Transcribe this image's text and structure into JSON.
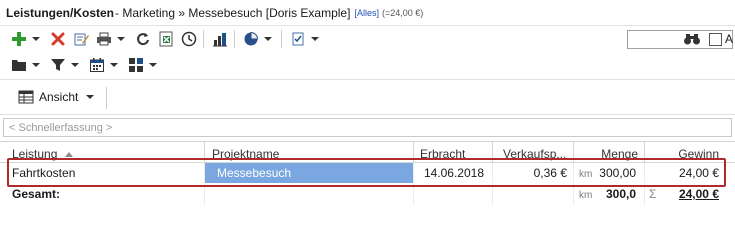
{
  "title": {
    "app": "Leistungen/Kosten",
    "path": " - Marketing » Messebesuch [Doris Example]",
    "filter": "[Alles]",
    "sum": "(=24,00 €)"
  },
  "toolbar": {
    "row1": [
      {
        "name": "add-icon",
        "color": "#2e9b2e"
      },
      {
        "name": "delete-icon",
        "color": "#d83b2e"
      },
      {
        "name": "edit-icon"
      },
      {
        "name": "print-icon"
      },
      {
        "name": "refresh-icon"
      },
      {
        "name": "excel-export-icon",
        "color": "#1d7a3a"
      },
      {
        "name": "clock-icon"
      },
      {
        "name": "report-icon"
      },
      {
        "name": "pie-chart-icon"
      },
      {
        "name": "checklist-icon"
      }
    ],
    "row2": [
      {
        "name": "folder-icon"
      },
      {
        "name": "filter-icon"
      },
      {
        "name": "calendar-icon"
      },
      {
        "name": "layout-icon"
      }
    ]
  },
  "search": {
    "value": "",
    "placeholder": ""
  },
  "checkbox": {
    "label": "A",
    "checked": false
  },
  "view": {
    "label": "Ansicht"
  },
  "quickentry": {
    "placeholder": "< Schnellerfassung >"
  },
  "grid": {
    "headers": {
      "leistung": "Leistung",
      "projektname": "Projektname",
      "erbracht": "Erbracht",
      "verkaufspreis": "Verkaufsp...",
      "menge": "Menge",
      "gewinn": "Gewinn"
    },
    "rows": [
      {
        "leistung": "Fahrtkosten",
        "projektname": "Messebesuch",
        "erbracht": "14.06.2018",
        "verkaufspreis": "0,36 €",
        "unit": "km",
        "menge": "300,00",
        "gewinn": "24,00 €"
      }
    ],
    "total": {
      "label": "Gesamt:",
      "unit": "km",
      "menge": "300,0",
      "sigma": "Σ",
      "gewinn": "24,00 €"
    }
  }
}
